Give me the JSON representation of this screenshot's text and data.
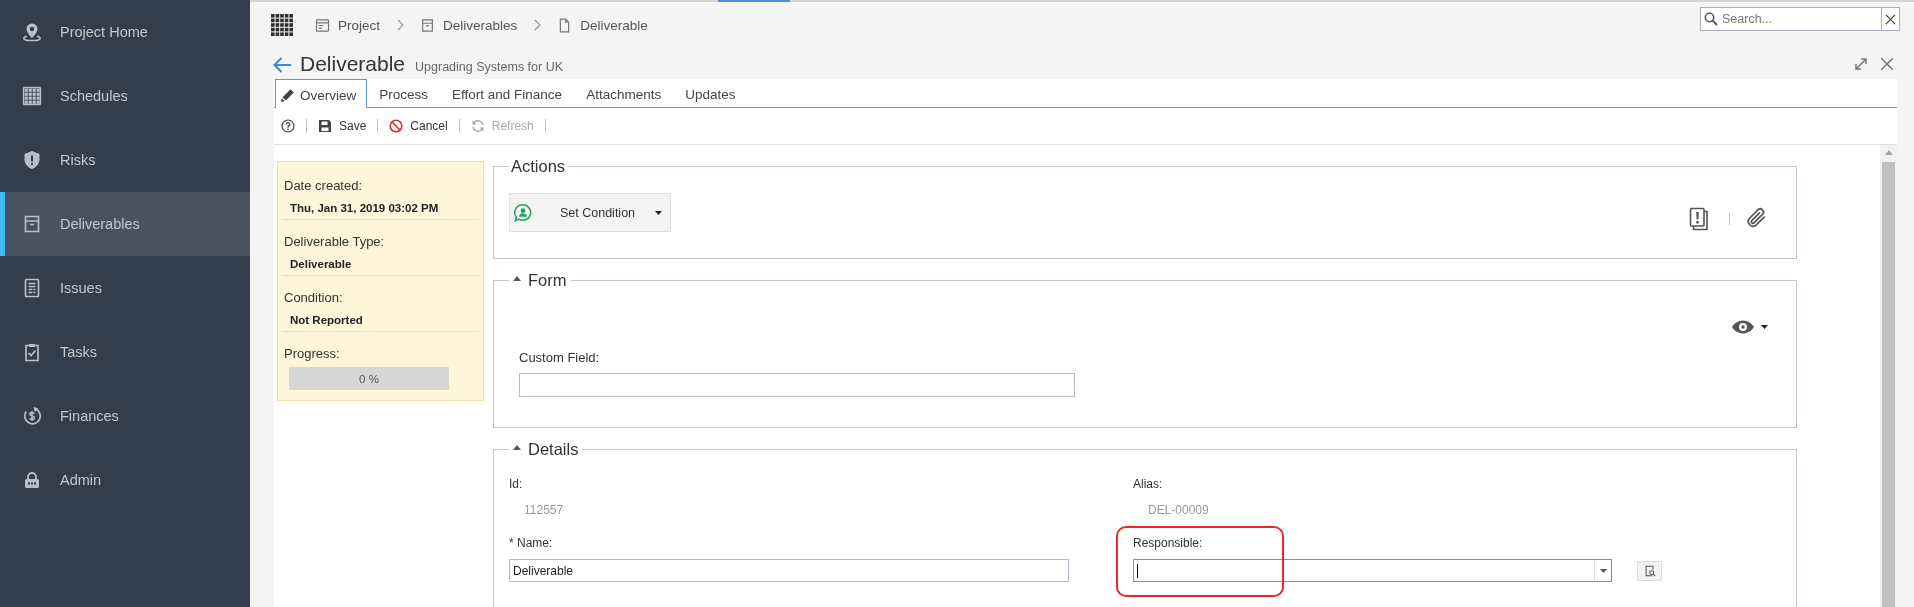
{
  "sidebar": {
    "items": [
      {
        "label": "Project Home",
        "selected": false
      },
      {
        "label": "Schedules",
        "selected": false
      },
      {
        "label": "Risks",
        "selected": false
      },
      {
        "label": "Deliverables",
        "selected": true
      },
      {
        "label": "Issues",
        "selected": false
      },
      {
        "label": "Tasks",
        "selected": false
      },
      {
        "label": "Finances",
        "selected": false
      },
      {
        "label": "Admin",
        "selected": false
      }
    ]
  },
  "breadcrumbs": [
    {
      "label": "Project"
    },
    {
      "label": "Deliverables"
    },
    {
      "label": "Deliverable"
    }
  ],
  "search": {
    "placeholder": "Search..."
  },
  "page": {
    "title": "Deliverable",
    "subtitle": "Upgrading Systems for UK"
  },
  "tabs": [
    {
      "label": "Overview",
      "selected": true
    },
    {
      "label": "Process",
      "selected": false
    },
    {
      "label": "Effort and Finance",
      "selected": false
    },
    {
      "label": "Attachments",
      "selected": false
    },
    {
      "label": "Updates",
      "selected": false
    }
  ],
  "toolbar": {
    "buttons": [
      {
        "label": "Save",
        "disabled": false
      },
      {
        "label": "Cancel",
        "disabled": false
      },
      {
        "label": "Refresh",
        "disabled": true
      }
    ]
  },
  "summary": [
    {
      "kind": "text",
      "label": "Date created:",
      "value": "Thu, Jan 31, 2019 03:02 PM"
    },
    {
      "kind": "text",
      "label": "Deliverable Type:",
      "value": "Deliverable"
    },
    {
      "kind": "text",
      "label": "Condition:",
      "value": "Not Reported"
    },
    {
      "kind": "progress",
      "label": "Progress:",
      "level": 0,
      "reading": "0 %"
    }
  ],
  "actions": {
    "title": "Actions",
    "button": {
      "label": "Set Condition"
    }
  },
  "form": {
    "title": "Form",
    "expanded": true,
    "fields": [
      {
        "label": "Custom Field:"
      }
    ]
  },
  "details": {
    "title": "Details",
    "expanded": true,
    "info": [
      {
        "label": "Id:",
        "value": "112557"
      },
      {
        "label": "Alias:",
        "value": "DEL-00009"
      }
    ],
    "inputs": [
      {
        "kind": "text",
        "label": "* Name:",
        "value": "Deliverable",
        "focused": false,
        "annotated": false
      },
      {
        "kind": "select",
        "label": "Responsible:",
        "focused": true,
        "annotated": true
      }
    ]
  }
}
